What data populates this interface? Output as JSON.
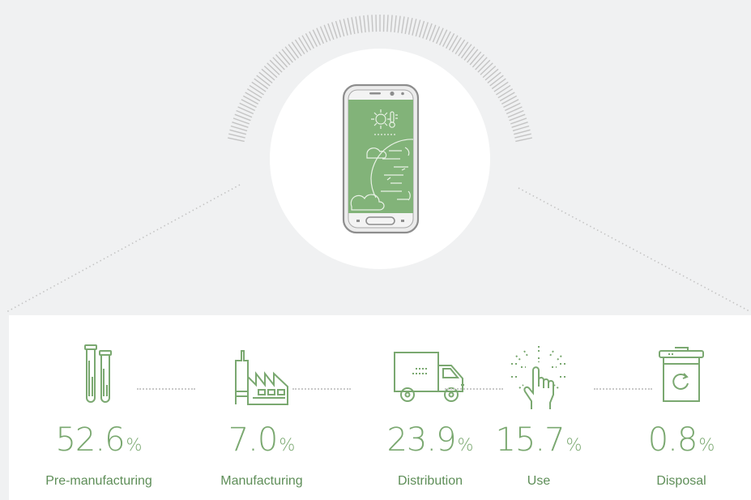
{
  "diagram": {
    "accent_color": "#7aa870",
    "label_color": "#5e8e58",
    "background_color": "#f0f1f2",
    "center_image": "smartphone-with-sun-thermometer-earth-icon",
    "stages": [
      {
        "icon": "test-tubes-icon",
        "value": "52.6",
        "unit": "%",
        "label": "Pre-manufacturing"
      },
      {
        "icon": "factory-icon",
        "value": "7.0",
        "unit": "%",
        "label": "Manufacturing"
      },
      {
        "icon": "delivery-truck-icon",
        "value": "23.9",
        "unit": "%",
        "label": "Distribution"
      },
      {
        "icon": "tapping-hand-icon",
        "value": "15.7",
        "unit": "%",
        "label": "Use"
      },
      {
        "icon": "recycling-bin-icon",
        "value": "0.8",
        "unit": "%",
        "label": "Disposal"
      }
    ]
  }
}
